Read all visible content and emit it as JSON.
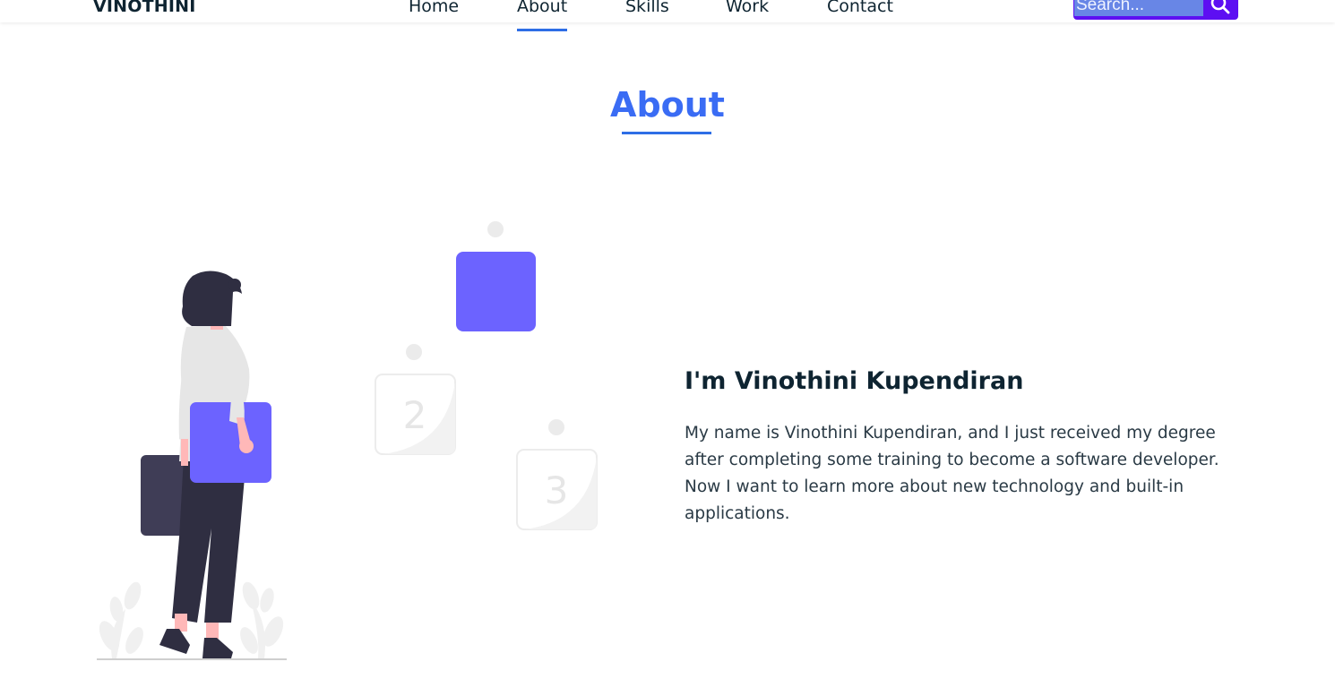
{
  "header": {
    "logo": "VINOTHINI",
    "nav": [
      {
        "label": "Home",
        "active": false
      },
      {
        "label": "About",
        "active": true
      },
      {
        "label": "Skills",
        "active": false
      },
      {
        "label": "Work",
        "active": false
      },
      {
        "label": "Contact",
        "active": false
      }
    ],
    "search": {
      "placeholder": "Search...",
      "icon": "search-icon"
    }
  },
  "about": {
    "title": "About",
    "heading": "I'm Vinothini Kupendiran",
    "paragraph": "My name is Vinothini Kupendiran, and I just received my degree after completing some training to become a software developer. Now I want to learn more about new technology and built-in applications.",
    "illustration": {
      "cards": [
        "2",
        "3"
      ]
    }
  },
  "colors": {
    "accent": "#3a6cf4",
    "underline": "#2e6ee6",
    "search_bg": "#5d0ff2",
    "search_field": "#6886e6",
    "illustration_purple": "#6c63ff",
    "text_dark": "#0e2431"
  }
}
